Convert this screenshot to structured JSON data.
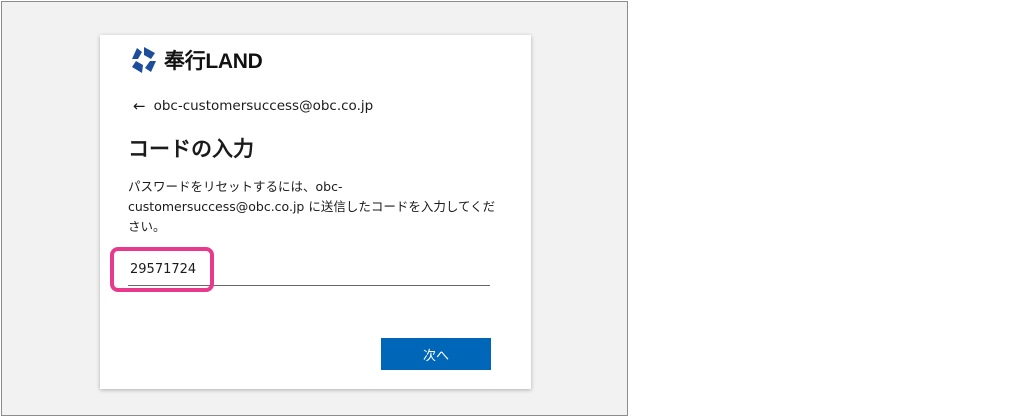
{
  "brand": {
    "logo_text": "奉行LAND",
    "icon": "obc-logo-icon"
  },
  "signin": {
    "back_icon": "back-arrow-icon",
    "back_arrow": "←",
    "account_email": "obc-customersuccess@obc.co.jp"
  },
  "page": {
    "title": "コードの入力",
    "description": "パスワードをリセットするには、obc-customersuccess@obc.co.jp に送信したコードを入力してください。"
  },
  "code_field": {
    "value": "29571724"
  },
  "actions": {
    "next_label": "次へ"
  },
  "colors": {
    "primary_button": "#0067b8",
    "highlight": "#e83a8c",
    "logo_blue": "#1c4e9c"
  }
}
